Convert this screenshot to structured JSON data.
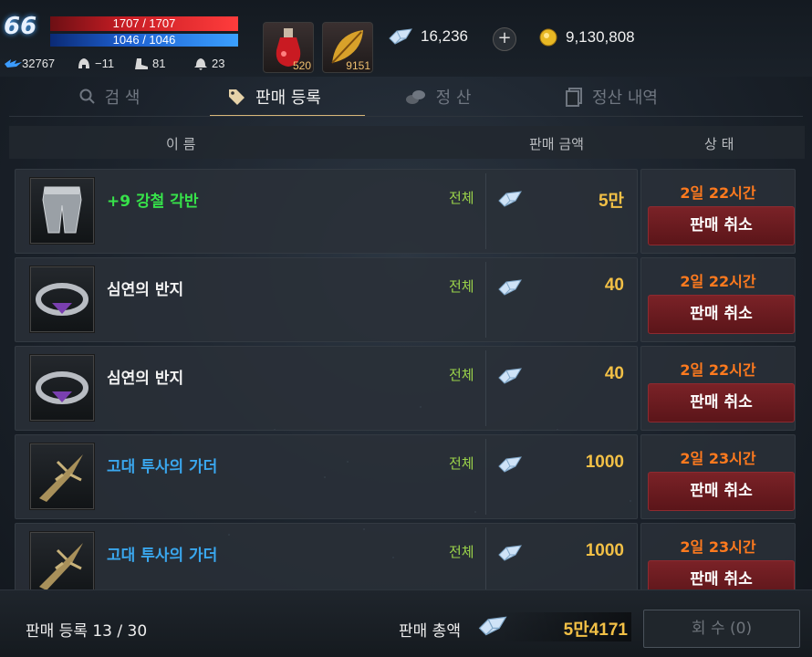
{
  "player": {
    "level": "66",
    "hp": "1707 / 1707",
    "mp": "1046 / 1046",
    "stats": [
      {
        "icon": "wing-icon",
        "value": "32767"
      },
      {
        "icon": "helmet-icon",
        "value": "−11"
      },
      {
        "icon": "boot-icon",
        "value": "81"
      },
      {
        "icon": "bell-icon",
        "value": "23"
      }
    ]
  },
  "quick_items": [
    {
      "icon": "red-potion-icon",
      "count": "520"
    },
    {
      "icon": "golden-leaf-icon",
      "count": "9151"
    }
  ],
  "currency": {
    "diamonds": "16,236",
    "gold": "9,130,808"
  },
  "tabs": [
    {
      "label": "검 색",
      "icon": "search-icon"
    },
    {
      "label": "판매 등록",
      "icon": "price-tag-icon"
    },
    {
      "label": "정 산",
      "icon": "coins-icon"
    },
    {
      "label": "정산 내역",
      "icon": "receipt-icon"
    }
  ],
  "header": {
    "name": "이 름",
    "price": "판매 금액",
    "status": "상 태"
  },
  "rows": [
    {
      "name": "+9 강철 각반",
      "name_color": "#37e24a",
      "icon": "steel-greaves-icon",
      "scope": "전체",
      "price": "5만",
      "time": "2일 22시간",
      "cancel": "판매 취소"
    },
    {
      "name": "심연의 반지",
      "name_color": "#f2f2f2",
      "icon": "abyss-ring-icon",
      "scope": "전체",
      "price": "40",
      "time": "2일 22시간",
      "cancel": "판매 취소"
    },
    {
      "name": "심연의 반지",
      "name_color": "#f2f2f2",
      "icon": "abyss-ring-icon",
      "scope": "전체",
      "price": "40",
      "time": "2일 22시간",
      "cancel": "판매 취소"
    },
    {
      "name": "고대 투사의 가더",
      "name_color": "#3aa7ee",
      "icon": "ancient-dagger-icon",
      "scope": "전체",
      "price": "1000",
      "time": "2일 23시간",
      "cancel": "판매 취소"
    },
    {
      "name": "고대 투사의 가더",
      "name_color": "#3aa7ee",
      "icon": "ancient-dagger-icon",
      "scope": "전체",
      "price": "1000",
      "time": "2일 23시간",
      "cancel": "판매 취소"
    }
  ],
  "footer": {
    "count": "판매 등록 13 / 30",
    "total_label": "판매 총액",
    "total": "5만4171",
    "collect": "회 수 (0)"
  }
}
